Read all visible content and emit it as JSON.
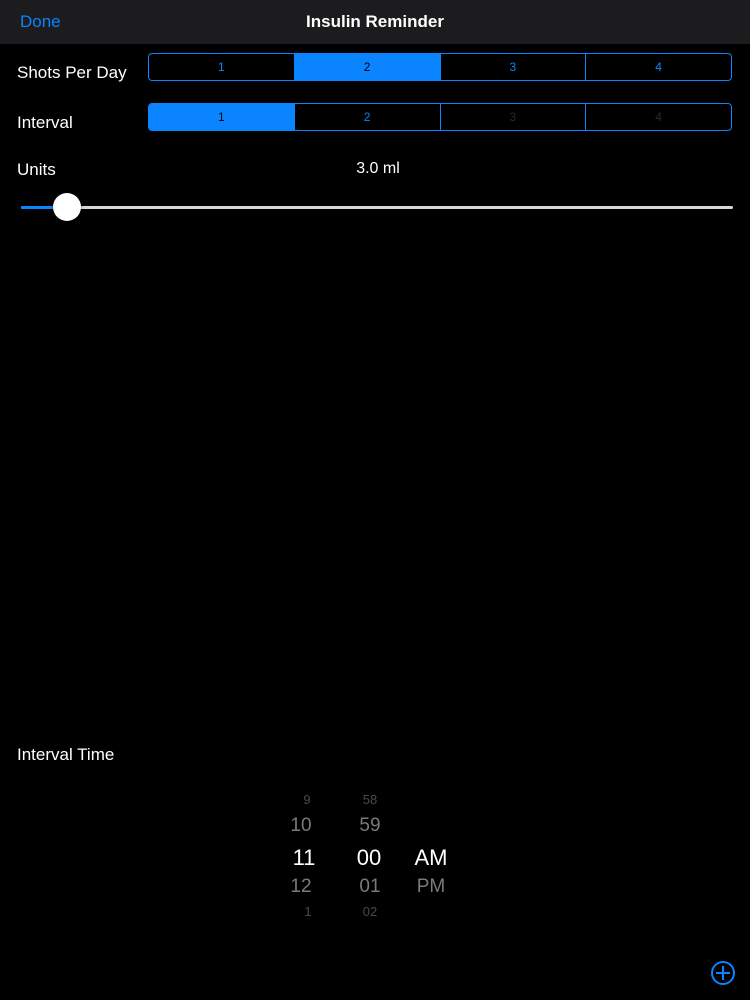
{
  "nav": {
    "done_label": "Done",
    "title": "Insulin Reminder"
  },
  "shots_per_day": {
    "label": "Shots Per Day",
    "options": [
      "1",
      "2",
      "3",
      "4"
    ],
    "selected": "2"
  },
  "interval": {
    "label": "Interval",
    "options": [
      "1",
      "2",
      "3",
      "4"
    ],
    "selected": "1",
    "disabled": [
      "3",
      "4"
    ]
  },
  "units": {
    "label": "Units",
    "value_text": "3.0 ml",
    "slider_fraction": 0.065
  },
  "interval_time": {
    "label": "Interval Time",
    "hours": [
      "9",
      "10",
      "11",
      "12",
      "1"
    ],
    "minutes": [
      "58",
      "59",
      "00",
      "01",
      "02"
    ],
    "period": [
      "AM",
      "PM"
    ],
    "selected": {
      "hour": "11",
      "minute": "00",
      "period": "AM"
    }
  },
  "colors": {
    "accent": "#0a84ff",
    "background": "#000000",
    "nav_background": "#1c1c1e"
  },
  "icons": {
    "add": "plus-circle-icon"
  }
}
